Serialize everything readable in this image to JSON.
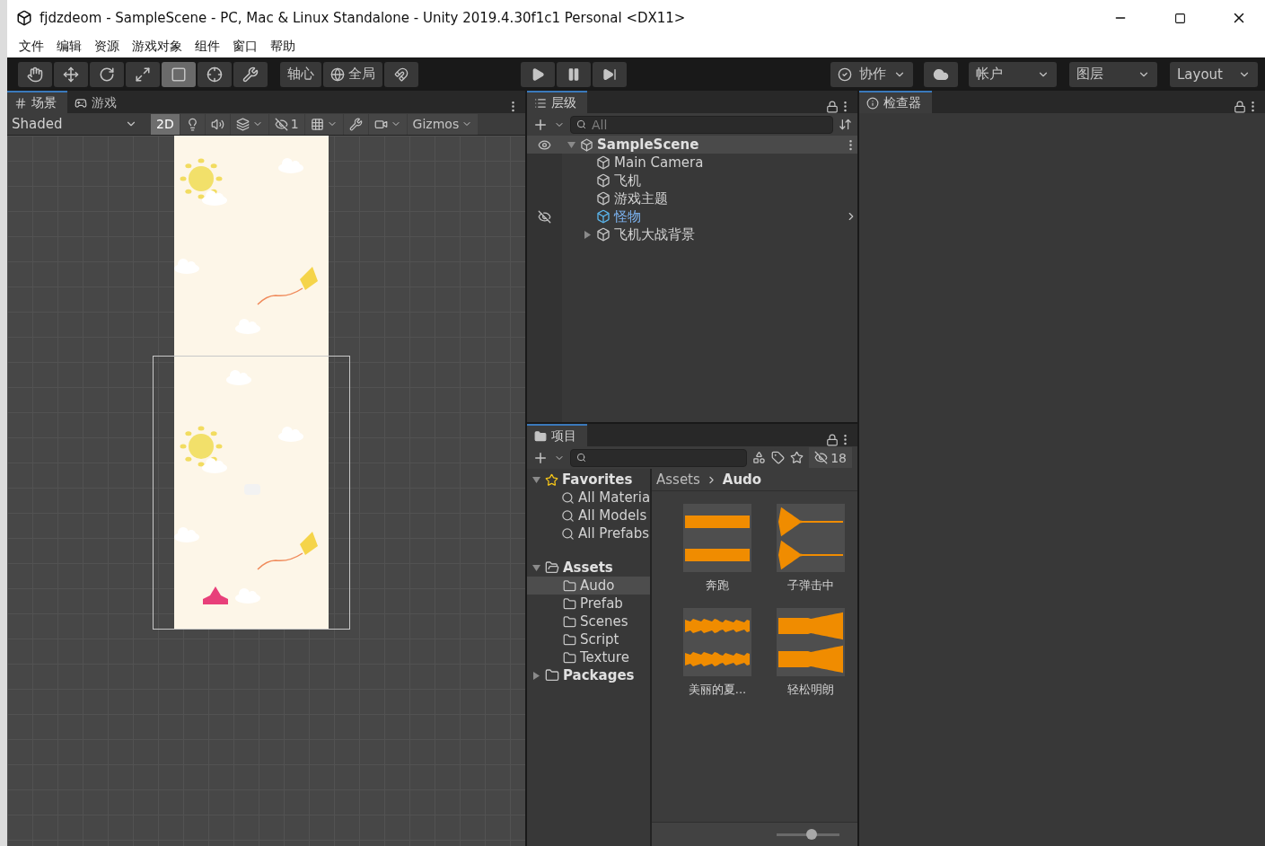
{
  "window": {
    "title": "fjdzdeom - SampleScene - PC, Mac & Linux Standalone - Unity 2019.4.30f1c1 Personal <DX11>"
  },
  "menu": [
    "文件",
    "编辑",
    "资源",
    "游戏对象",
    "组件",
    "窗口",
    "帮助"
  ],
  "toolbar": {
    "tools": [
      {
        "kind": "hand",
        "selected": false
      },
      {
        "kind": "move",
        "selected": false
      },
      {
        "kind": "rotate",
        "selected": false
      },
      {
        "kind": "scale",
        "selected": false
      },
      {
        "kind": "rect",
        "selected": true
      },
      {
        "kind": "transform",
        "selected": false
      },
      {
        "kind": "custom",
        "selected": false
      }
    ],
    "pivot": "轴心",
    "space": "全局",
    "playback": [
      {
        "kind": "play"
      },
      {
        "kind": "pause"
      },
      {
        "kind": "step"
      }
    ],
    "collab": "协作",
    "account": "帐户",
    "layers": "图层",
    "layout": "Layout"
  },
  "scene_panel": {
    "tabs": [
      {
        "label": "场景",
        "kind": "scene",
        "selected": true
      },
      {
        "label": "游戏",
        "kind": "game",
        "selected": false
      }
    ],
    "shading": "Shaded",
    "mode_2d": {
      "label": "2D",
      "on": true
    },
    "hidden_count": "1",
    "gizmos": "Gizmos"
  },
  "hierarchy": {
    "tab": "层级",
    "search_placeholder": "All",
    "scene": "SampleScene",
    "items": [
      {
        "label": "Main Camera",
        "kind": "object",
        "expandable": false
      },
      {
        "label": "飞机",
        "kind": "object",
        "expandable": false
      },
      {
        "label": "游戏主题",
        "kind": "object",
        "expandable": false
      },
      {
        "label": "怪物",
        "kind": "prefab",
        "expandable": false
      },
      {
        "label": "飞机大战背景",
        "kind": "object",
        "expandable": true
      }
    ]
  },
  "project": {
    "tab": "项目",
    "hidden_count": "18",
    "favorites": {
      "label": "Favorites",
      "expanded": true,
      "children": [
        {
          "label": "All Materia"
        },
        {
          "label": "All Models"
        },
        {
          "label": "All Prefabs"
        }
      ]
    },
    "folders": [
      {
        "label": "Assets",
        "expanded": true,
        "selected": false,
        "children": [
          {
            "label": "Audo",
            "selected": true
          },
          {
            "label": "Prefab",
            "selected": false
          },
          {
            "label": "Scenes",
            "selected": false
          },
          {
            "label": "Script",
            "selected": false
          },
          {
            "label": "Texture",
            "selected": false
          }
        ]
      },
      {
        "label": "Packages",
        "expanded": false,
        "selected": false
      }
    ],
    "breadcrumb": [
      "Assets",
      "Audo"
    ],
    "files": [
      {
        "name": "奔跑"
      },
      {
        "name": "子弹击中"
      },
      {
        "name": "美丽的夏..."
      },
      {
        "name": "轻松明朗"
      }
    ],
    "icon_size": {
      "level": 0.55
    }
  },
  "inspector": {
    "tab": "检查器"
  }
}
